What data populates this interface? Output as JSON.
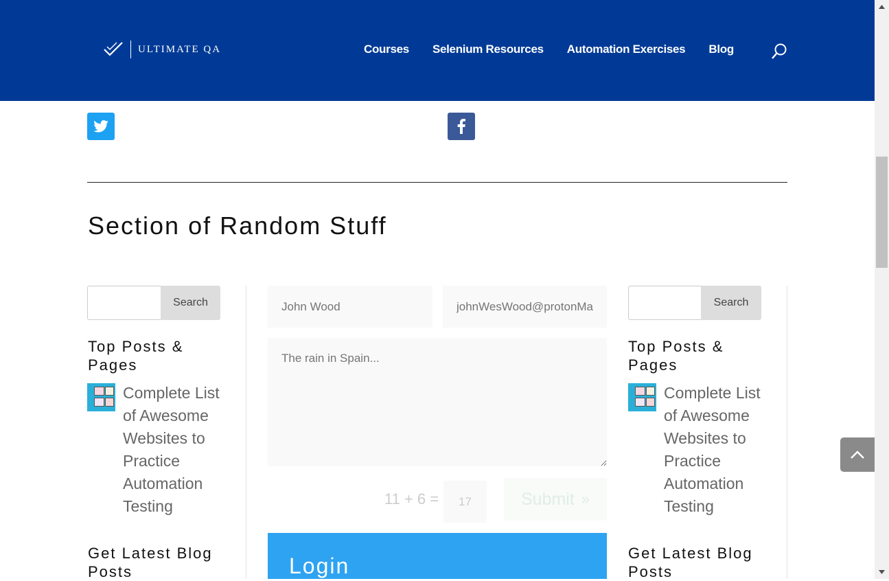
{
  "header": {
    "logo_text": "ULTIMATE QA",
    "nav": [
      "Courses",
      "Selenium Resources",
      "Automation Exercises",
      "Blog"
    ],
    "search_icon": "search-icon"
  },
  "social": {
    "twitter_icon": "twitter-icon",
    "facebook_icon": "facebook-icon"
  },
  "section": {
    "title": "Section of Random Stuff"
  },
  "sidebar_left": {
    "search_button": "Search",
    "search_value": "",
    "top_posts_title": "Top Posts & Pages",
    "post_link": "Complete List of Awesome Websites to Practice Automation Testing",
    "latest_title": "Get Latest Blog Posts"
  },
  "sidebar_right": {
    "search_button": "Search",
    "search_value": "",
    "top_posts_title": "Top Posts & Pages",
    "post_link": "Complete List of Awesome Websites to Practice Automation Testing",
    "latest_title": "Get Latest Blog Posts"
  },
  "contact_form": {
    "name_placeholder": "John Wood",
    "email_placeholder": "johnWesWood@protonMail.com",
    "message_placeholder": "The rain in Spain...",
    "captcha_question": "11 + 6 =",
    "captcha_answer": "17",
    "submit_label": "Submit",
    "submit_icon": "double-chevron-right-icon"
  },
  "login": {
    "title": "Login"
  },
  "colors": {
    "header_bg": "#003a96",
    "twitter": "#1da1f2",
    "facebook": "#3b5998",
    "login_bg": "#2ea3f2"
  }
}
